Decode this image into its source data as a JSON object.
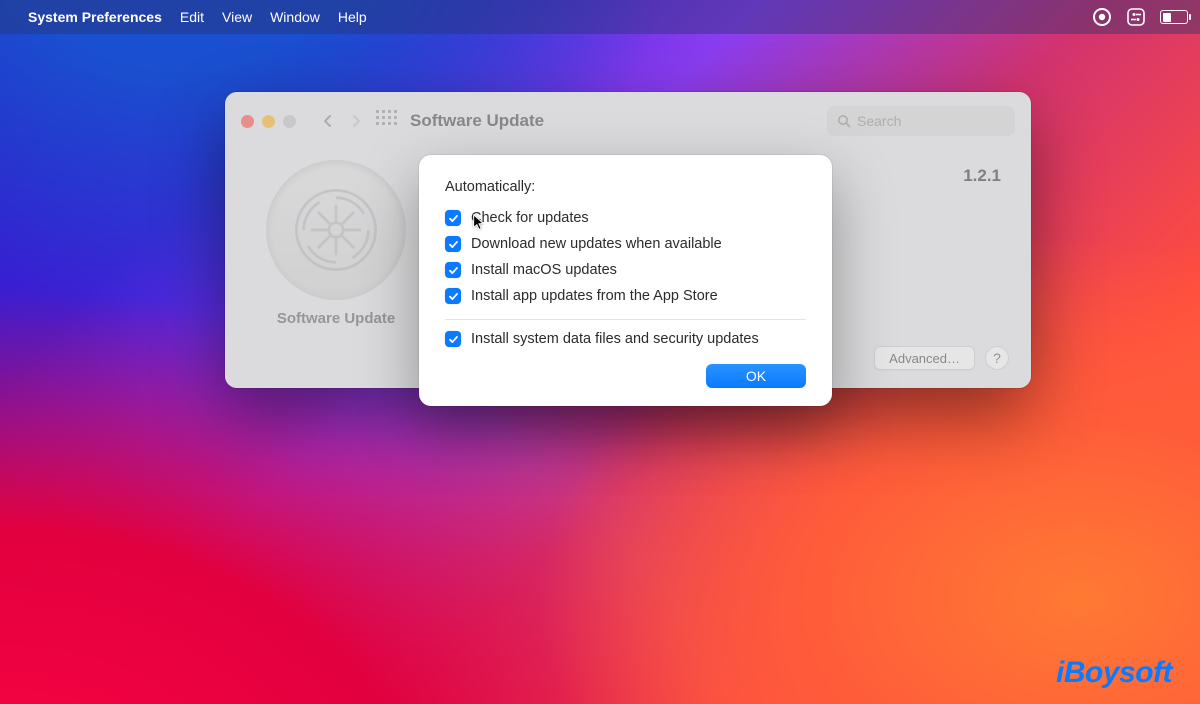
{
  "menubar": {
    "app": "System Preferences",
    "items": [
      "Edit",
      "View",
      "Window",
      "Help"
    ]
  },
  "window": {
    "title": "Software Update",
    "search_placeholder": "Search",
    "gear_label": "Software Update",
    "version_text": "1.2.1",
    "advanced_label": "Advanced…",
    "help_label": "?"
  },
  "sheet": {
    "heading": "Automatically:",
    "options": [
      "Check for updates",
      "Download new updates when available",
      "Install macOS updates",
      "Install app updates from the App Store"
    ],
    "security_option": "Install system data files and security updates",
    "ok_label": "OK"
  },
  "watermark": "iBoysoft",
  "colors": {
    "accent": "#0a7aff"
  }
}
